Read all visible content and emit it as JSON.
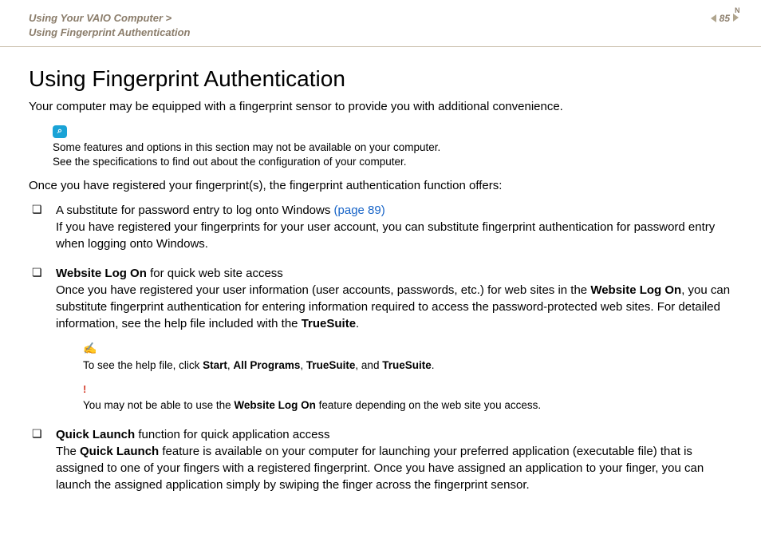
{
  "header": {
    "breadcrumb_line1": "Using Your VAIO Computer",
    "breadcrumb_sep": ">",
    "breadcrumb_line2": "Using Fingerprint Authentication",
    "page_number": "85",
    "nav_label": "N"
  },
  "title": "Using Fingerprint Authentication",
  "intro": "Your computer may be equipped with a fingerprint sensor to provide you with additional convenience.",
  "search_icon_glyph": "⌕",
  "note1_line1": "Some features and options in this section may not be available on your computer.",
  "note1_line2": "See the specifications to find out about the configuration of your computer.",
  "preamble": "Once you have registered your fingerprint(s), the fingerprint authentication function offers:",
  "items": [
    {
      "lead_plain": "A substitute for password entry to log onto Windows ",
      "lead_link": "(page 89)",
      "body": "If you have registered your fingerprints for your user account, you can substitute fingerprint authentication for password entry when logging onto Windows."
    },
    {
      "lead_bold": "Website Log On",
      "lead_rest": " for quick web site access",
      "body_pre": "Once you have registered your user information (user accounts, passwords, etc.) for web sites in the ",
      "body_bold1": "Website Log On",
      "body_mid": ", you can substitute fingerprint authentication for entering information required to access the password-protected web sites. For detailed information, see the help file included with the ",
      "body_bold2": "TrueSuite",
      "body_end": "."
    },
    {
      "lead_bold": "Quick Launch",
      "lead_rest": " function for quick application access",
      "body_pre": "The ",
      "body_bold1": "Quick Launch",
      "body_rest": " feature is available on your computer for launching your preferred application (executable file) that is assigned to one of your fingers with a registered fingerprint. Once you have assigned an application to your finger, you can launch the assigned application simply by swiping the finger across the fingerprint sensor."
    }
  ],
  "hand_icon_glyph": "✍",
  "help_note": {
    "pre": "To see the help file, click ",
    "b1": "Start",
    "sep": ", ",
    "b2": "All Programs",
    "b3": "TrueSuite",
    "and": ", and ",
    "b4": "TrueSuite",
    "end": "."
  },
  "bang_glyph": "!",
  "warn_note": {
    "pre": "You may not be able to use the ",
    "b1": "Website Log On",
    "post": " feature depending on the web site you access."
  }
}
